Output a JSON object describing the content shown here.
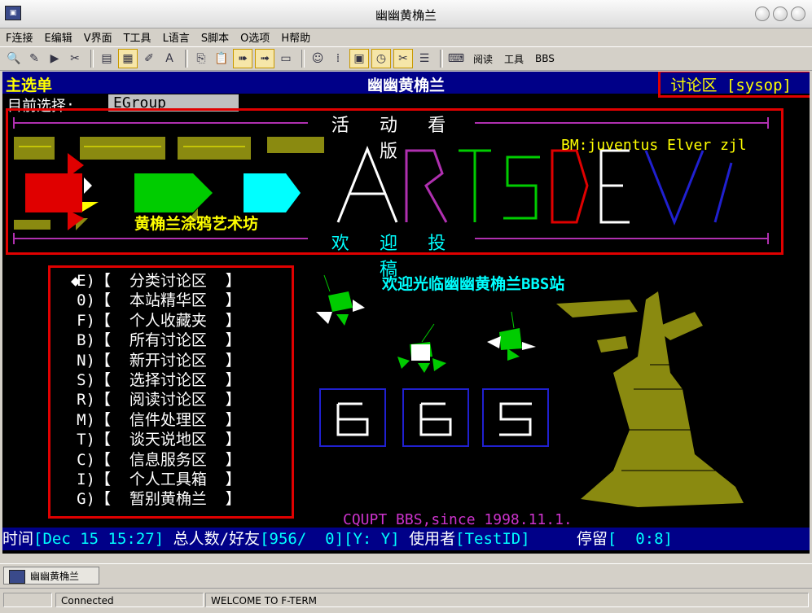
{
  "window": {
    "title": "幽幽黄桷兰"
  },
  "menubar": [
    "F连接",
    "E编辑",
    "V界面",
    "T工具",
    "L语言",
    "S脚本",
    "O选项",
    "H帮助"
  ],
  "toolbar": {
    "text_buttons": [
      "阅读",
      "工具",
      "BBS"
    ]
  },
  "terminal": {
    "header": {
      "left": "主选单",
      "center": "幽幽黄桷兰",
      "right": "讨论区 [sysop]"
    },
    "selection": {
      "label": "目前选择:",
      "value": "EGroup"
    },
    "board": {
      "title": "活 动 看 版",
      "bm": "BM:juventus Elver zjl",
      "art_caption": "黄桷兰涂鸦艺术坊",
      "art_letters": "ARTSDEV",
      "footer": "欢 迎 投 稿"
    },
    "menu": [
      {
        "key": "E)",
        "label": "【  分类讨论区  】",
        "selected": true
      },
      {
        "key": "0)",
        "label": "【  本站精华区  】"
      },
      {
        "key": "F)",
        "label": "【  个人收藏夹  】"
      },
      {
        "key": "B)",
        "label": "【  所有讨论区  】"
      },
      {
        "key": "N)",
        "label": "【  新开讨论区  】"
      },
      {
        "key": "S)",
        "label": "【  选择讨论区  】"
      },
      {
        "key": "R)",
        "label": "【  阅读讨论区  】"
      },
      {
        "key": "M)",
        "label": "【  信件处理区  】"
      },
      {
        "key": "T)",
        "label": "【  谈天说地区  】"
      },
      {
        "key": "C)",
        "label": "【  信息服务区  】"
      },
      {
        "key": "I)",
        "label": "【  个人工具箱  】"
      },
      {
        "key": "G)",
        "label": "【  暂别黄桷兰  】"
      }
    ],
    "menu_cursor": "◆",
    "welcome": "欢迎光临幽幽黄桷兰BBS站",
    "bbs_art": "BBS",
    "since": "CQUPT BBS,since 1998.11.1.",
    "status": {
      "time_label": "时间",
      "time_value": "[Dec 15 15:27]",
      "users_label": "总人数/好友",
      "users_value": "[956/  0]",
      "flags": "[Y: Y]",
      "user_label": "使用者",
      "user_value": "[TestID]",
      "stay_label": "停留",
      "stay_value": "[  0:8]"
    }
  },
  "taskbar": {
    "item": "幽幽黄桷兰"
  },
  "statusbar": {
    "connection": "Connected",
    "message": "WELCOME TO F-TERM"
  }
}
